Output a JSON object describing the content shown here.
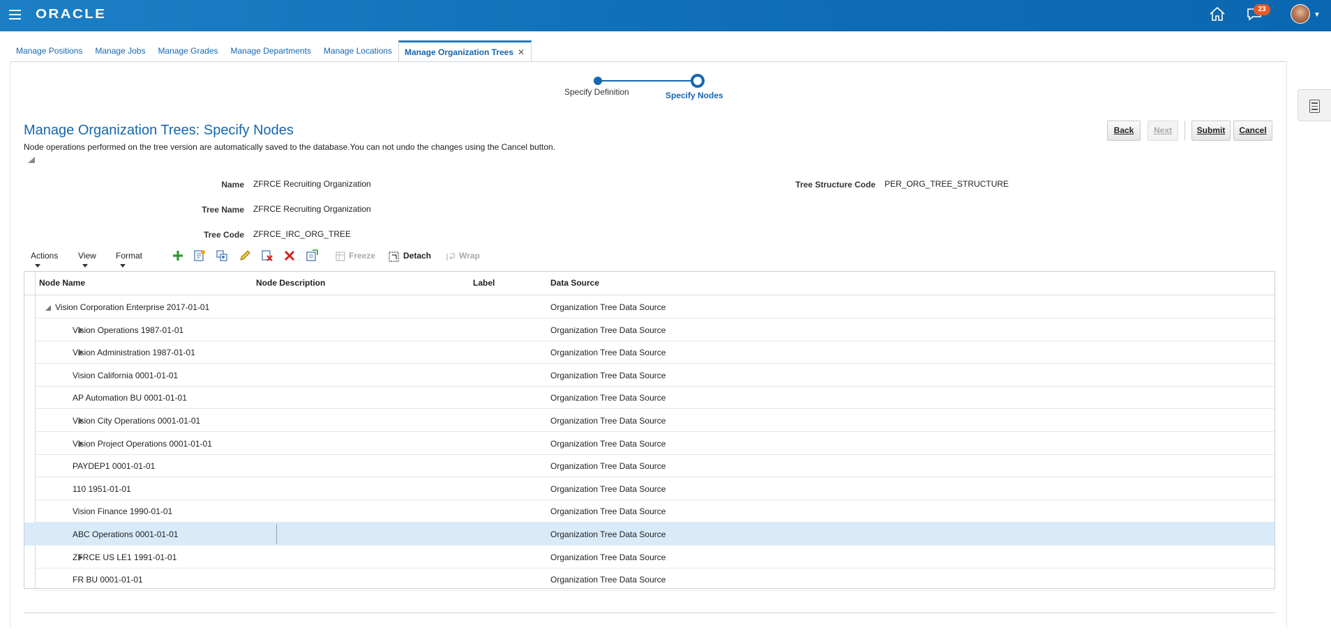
{
  "header": {
    "logo": "ORACLE",
    "notification_count": "23"
  },
  "tabs": [
    {
      "label": "Manage Positions"
    },
    {
      "label": "Manage Jobs"
    },
    {
      "label": "Manage Grades"
    },
    {
      "label": "Manage Departments"
    },
    {
      "label": "Manage Locations"
    },
    {
      "label": "Manage Organization Trees",
      "active": true
    }
  ],
  "train": {
    "step1": "Specify Definition",
    "step2": "Specify Nodes"
  },
  "page": {
    "title": "Manage Organization Trees: Specify Nodes",
    "note": "Node operations performed on the tree version are automatically saved to the database.You can not undo the changes using the Cancel button."
  },
  "buttons": {
    "back": "Back",
    "next": "Next",
    "submit": "Submit",
    "cancel": "Cancel"
  },
  "form": {
    "name_label": "Name",
    "name_value": "ZFRCE Recruiting Organization",
    "tree_name_label": "Tree Name",
    "tree_name_value": "ZFRCE Recruiting Organization",
    "tree_code_label": "Tree Code",
    "tree_code_value": "ZFRCE_IRC_ORG_TREE",
    "structure_label": "Tree Structure Code",
    "structure_value": "PER_ORG_TREE_STRUCTURE"
  },
  "toolbar": {
    "actions": "Actions",
    "view": "View",
    "format": "Format",
    "freeze": "Freeze",
    "detach": "Detach",
    "wrap": "Wrap"
  },
  "table": {
    "columns": [
      "Node Name",
      "Node Description",
      "Label",
      "Data Source"
    ],
    "rows": [
      {
        "name": "Vision Corporation Enterprise 2017-01-01",
        "source": "Organization Tree Data Source",
        "level": 0,
        "expander": "open"
      },
      {
        "name": "Vision Operations 1987-01-01",
        "source": "Organization Tree Data Source",
        "level": 1,
        "expander": "closed"
      },
      {
        "name": "Vision Administration 1987-01-01",
        "source": "Organization Tree Data Source",
        "level": 1,
        "expander": "closed"
      },
      {
        "name": "Vision California 0001-01-01",
        "source": "Organization Tree Data Source",
        "level": 1,
        "expander": "none"
      },
      {
        "name": "AP Automation BU 0001-01-01",
        "source": "Organization Tree Data Source",
        "level": 1,
        "expander": "none"
      },
      {
        "name": "Vision City Operations 0001-01-01",
        "source": "Organization Tree Data Source",
        "level": 1,
        "expander": "closed"
      },
      {
        "name": "Vision Project Operations 0001-01-01",
        "source": "Organization Tree Data Source",
        "level": 1,
        "expander": "closed"
      },
      {
        "name": "PAYDEP1 0001-01-01",
        "source": "Organization Tree Data Source",
        "level": 1,
        "expander": "none"
      },
      {
        "name": "110 1951-01-01",
        "source": "Organization Tree Data Source",
        "level": 1,
        "expander": "none"
      },
      {
        "name": "Vision Finance 1990-01-01",
        "source": "Organization Tree Data Source",
        "level": 1,
        "expander": "none"
      },
      {
        "name": "ABC Operations 0001-01-01",
        "source": "Organization Tree Data Source",
        "level": 1,
        "expander": "none",
        "selected": true
      },
      {
        "name": "ZFRCE US LE1 1991-01-01",
        "source": "Organization Tree Data Source",
        "level": 1,
        "expander": "closed"
      },
      {
        "name": "FR BU 0001-01-01",
        "source": "Organization Tree Data Source",
        "level": 1,
        "expander": "none"
      }
    ]
  }
}
